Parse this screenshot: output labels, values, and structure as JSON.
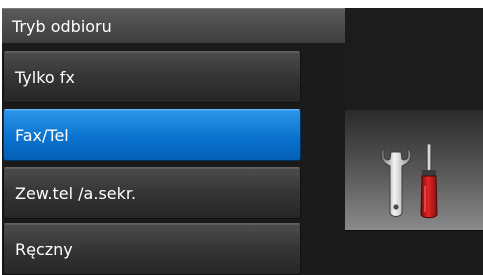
{
  "header": {
    "title": "Tryb odbioru"
  },
  "menu": {
    "items": [
      {
        "label": "Tylko fx"
      },
      {
        "label": "Fax/Tel"
      },
      {
        "label": "Zew.tel /a.sekr."
      },
      {
        "label": "Ręczny"
      }
    ],
    "selected_label": "Fax/Tel"
  },
  "settings_button": {
    "icon": "tools-icon"
  },
  "colors": {
    "selected_item": "#0a73cf",
    "item_background": "#353535",
    "screen_background": "#1a1a1a"
  }
}
